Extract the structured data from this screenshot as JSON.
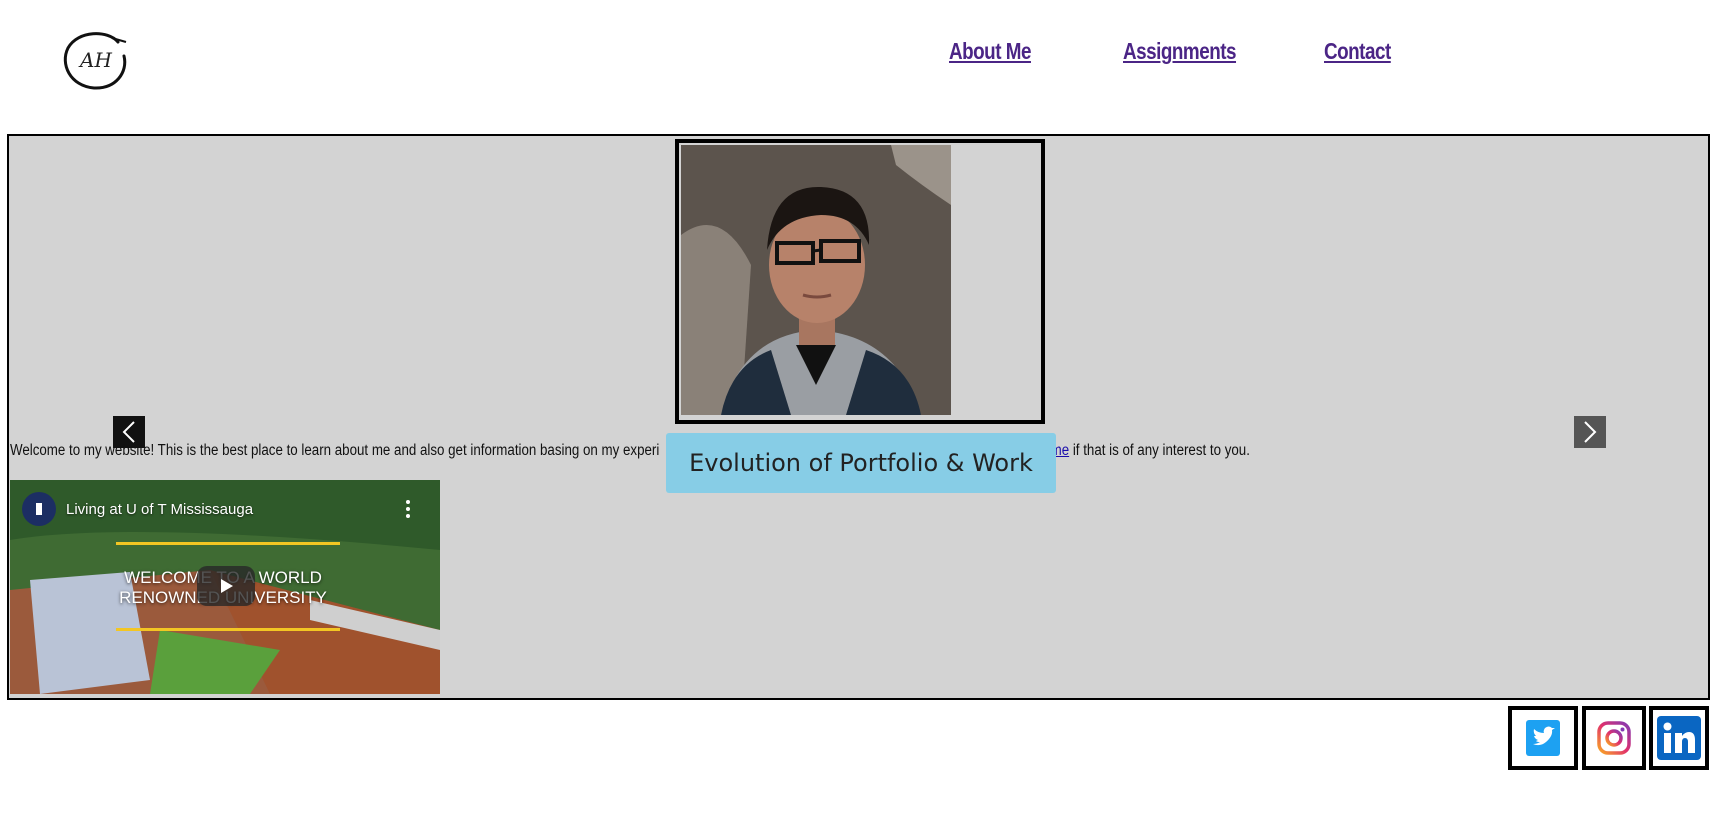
{
  "header": {
    "logo_text": "AH",
    "nav": [
      {
        "label": "About Me"
      },
      {
        "label": "Assignments"
      },
      {
        "label": "Contact"
      }
    ]
  },
  "carousel": {
    "caption": "Evolution of Portfolio & Work",
    "prev_icon": "chevron-left-icon",
    "next_icon": "chevron-right-icon"
  },
  "welcome": {
    "text_before": "Welcome to my website! This is the best place to learn about me and also get information basing on my experi",
    "link_text": "esume",
    "text_after": " if that is of any interest to you."
  },
  "video": {
    "title": "Living at U of T Mississauga",
    "overlay_line1": "WELCOME TO A WORLD",
    "overlay_line2": "RENOWNED UNIVERSITY"
  },
  "social": [
    {
      "icon": "twitter-icon",
      "color": "#1da1f2"
    },
    {
      "icon": "instagram-icon",
      "color": "#c13584"
    },
    {
      "icon": "linkedin-icon",
      "color": "#0a66c2"
    }
  ],
  "colors": {
    "nav_link": "#4b2586",
    "panel_bg": "#d3d3d3",
    "caption_bg": "#87cde6"
  }
}
